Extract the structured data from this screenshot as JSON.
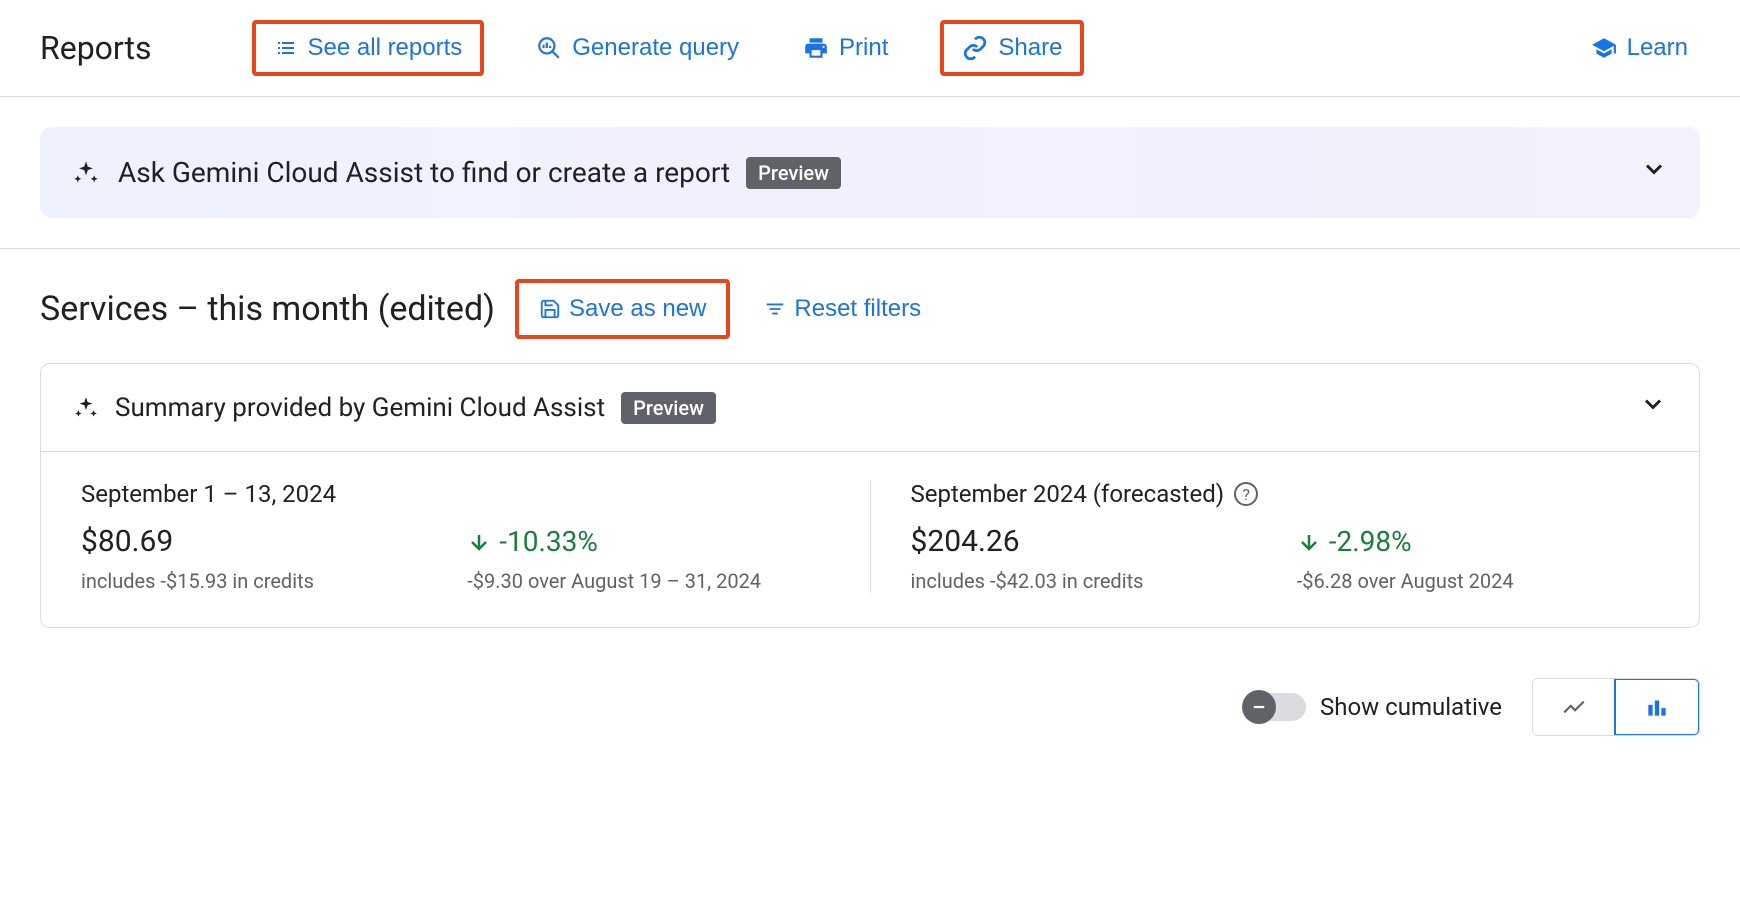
{
  "header": {
    "title": "Reports",
    "see_all": "See all reports",
    "generate_query": "Generate query",
    "print": "Print",
    "share": "Share",
    "learn": "Learn"
  },
  "gemini": {
    "banner_text": "Ask Gemini Cloud Assist to find or create a report",
    "preview_label": "Preview"
  },
  "report": {
    "title": "Services – this month (edited)",
    "save_as_new": "Save as new",
    "reset_filters": "Reset filters"
  },
  "summary": {
    "title": "Summary provided by Gemini Cloud Assist",
    "preview_label": "Preview",
    "left": {
      "range": "September 1 – 13, 2024",
      "amount": "$80.69",
      "credits_note": "includes -$15.93 in credits",
      "delta_pct": "-10.33%",
      "delta_note": "-$9.30 over August 19 – 31, 2024"
    },
    "right": {
      "range": "September 2024 (forecasted)",
      "amount": "$204.26",
      "credits_note": "includes -$42.03 in credits",
      "delta_pct": "-2.98%",
      "delta_note": "-$6.28 over August 2024"
    }
  },
  "bottom": {
    "show_cumulative": "Show cumulative"
  }
}
